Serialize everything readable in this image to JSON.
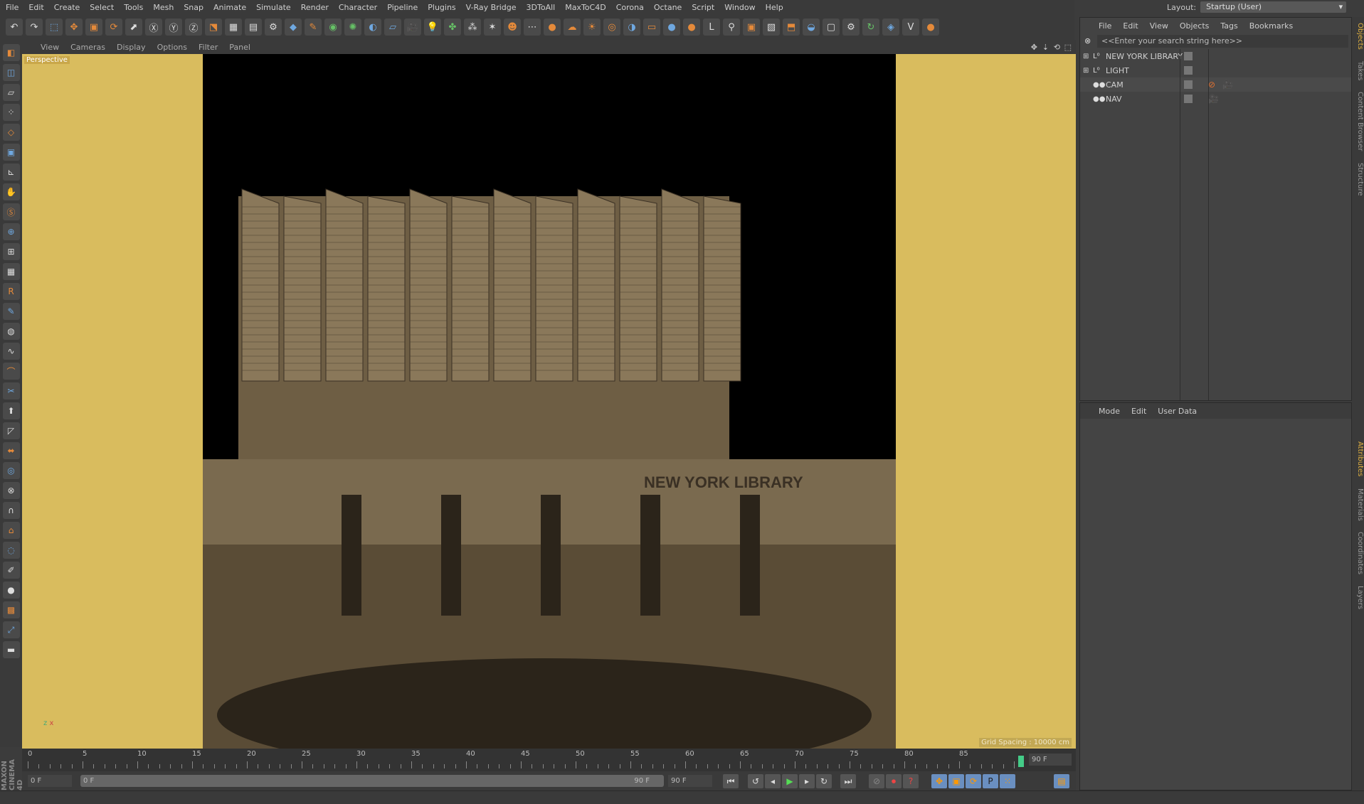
{
  "menu": [
    "File",
    "Edit",
    "Create",
    "Select",
    "Tools",
    "Mesh",
    "Snap",
    "Animate",
    "Simulate",
    "Render",
    "Character",
    "Pipeline",
    "Plugins",
    "V-Ray Bridge",
    "3DToAll",
    "MaxToC4D",
    "Corona",
    "Octane",
    "Script",
    "Window",
    "Help"
  ],
  "layout": {
    "label": "Layout:",
    "value": "Startup (User)"
  },
  "viewport": {
    "menu": [
      "View",
      "Cameras",
      "Display",
      "Options",
      "Filter",
      "Panel"
    ],
    "label": "Perspective",
    "grid_spacing": "Grid Spacing : 10000 cm",
    "axis_z": "z",
    "axis_x": "x"
  },
  "object_manager": {
    "menu": [
      "File",
      "Edit",
      "View",
      "Objects",
      "Tags",
      "Bookmarks"
    ],
    "search_placeholder": "<<Enter your search string here>>",
    "objects": [
      {
        "name": "NEW YORK LIBRARY",
        "type": "null"
      },
      {
        "name": "LIGHT",
        "type": "null"
      },
      {
        "name": "CAM",
        "type": "camera"
      },
      {
        "name": "NAV",
        "type": "camera"
      }
    ]
  },
  "attributes": {
    "menu": [
      "Mode",
      "Edit",
      "User Data"
    ]
  },
  "side_tabs": [
    "Objects",
    "Takes",
    "Content Browser",
    "Structure",
    "Attributes",
    "Materials",
    "Coordinates",
    "Layers"
  ],
  "timeline": {
    "ticks": [
      "0",
      "5",
      "10",
      "15",
      "20",
      "25",
      "30",
      "35",
      "40",
      "45",
      "50",
      "55",
      "60",
      "65",
      "70",
      "75",
      "80",
      "85"
    ],
    "end_field": "90 F",
    "current_frame": 90,
    "start": "0 F",
    "range_start": "0 F",
    "range_end": "90 F",
    "max": "90 F"
  },
  "brand": "MAXON CINEMA 4D"
}
